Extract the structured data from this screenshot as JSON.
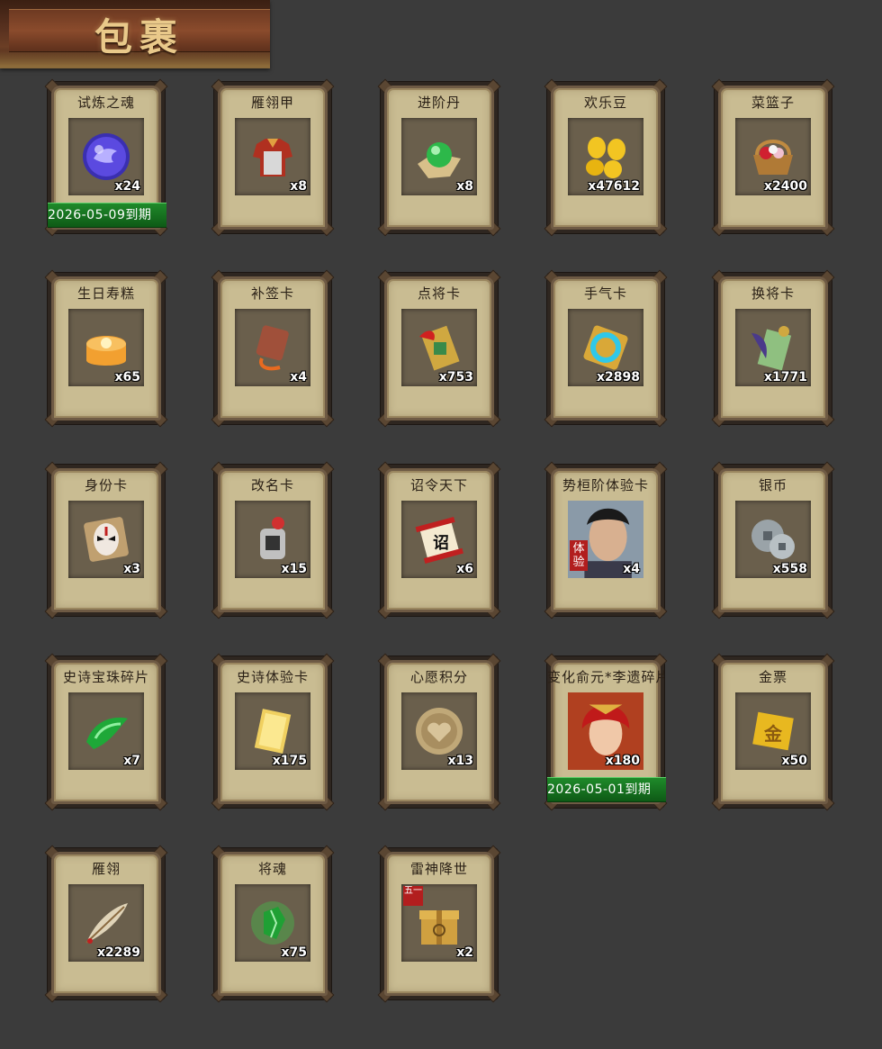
{
  "page_title": "包裹",
  "items": [
    {
      "name": "试炼之魂",
      "count": "x24",
      "icon": "purple-dragon-orb-icon",
      "expire": "2026-05-09到期"
    },
    {
      "name": "雁翎甲",
      "count": "x8",
      "icon": "armor-icon"
    },
    {
      "name": "进阶丹",
      "count": "x8",
      "icon": "green-pill-icon"
    },
    {
      "name": "欢乐豆",
      "count": "x47612",
      "icon": "gold-beans-icon"
    },
    {
      "name": "菜篮子",
      "count": "x2400",
      "icon": "flower-basket-icon"
    },
    {
      "name": "生日寿糕",
      "count": "x65",
      "icon": "birthday-cake-icon"
    },
    {
      "name": "补签卡",
      "count": "x4",
      "icon": "token-card-icon"
    },
    {
      "name": "点将卡",
      "count": "x753",
      "icon": "general-card-icon"
    },
    {
      "name": "手气卡",
      "count": "x2898",
      "icon": "luck-card-icon"
    },
    {
      "name": "换将卡",
      "count": "x1771",
      "icon": "swap-card-icon"
    },
    {
      "name": "身份卡",
      "count": "x3",
      "icon": "opera-mask-card-icon"
    },
    {
      "name": "改名卡",
      "count": "x15",
      "icon": "rename-card-icon"
    },
    {
      "name": "诏令天下",
      "count": "x6",
      "icon": "edict-scroll-icon"
    },
    {
      "name": "势桓阶体验卡",
      "count": "x4",
      "icon": "hero-portrait-icon",
      "tag": "体验"
    },
    {
      "name": "银币",
      "count": "x558",
      "icon": "silver-coins-icon"
    },
    {
      "name": "史诗宝珠碎片",
      "count": "x7",
      "icon": "green-gem-shard-icon"
    },
    {
      "name": "史诗体验卡",
      "count": "x175",
      "icon": "gold-card-icon"
    },
    {
      "name": "心愿积分",
      "count": "x13",
      "icon": "heart-coin-icon"
    },
    {
      "name": "变化俞元*李遗碎片",
      "count": "x180",
      "icon": "red-hero-portrait-icon",
      "expire": "2026-05-01到期"
    },
    {
      "name": "金票",
      "count": "x50",
      "icon": "gold-ticket-icon"
    },
    {
      "name": "雁翎",
      "count": "x2289",
      "icon": "feather-icon"
    },
    {
      "name": "将魂",
      "count": "x75",
      "icon": "green-crystal-icon"
    },
    {
      "name": "雷神降世",
      "count": "x2",
      "icon": "gift-box-icon",
      "badge": "五一"
    }
  ],
  "colors": {
    "background": "#3b3b3b",
    "card": "#c9bc92",
    "expire": "#1f8a2a"
  }
}
